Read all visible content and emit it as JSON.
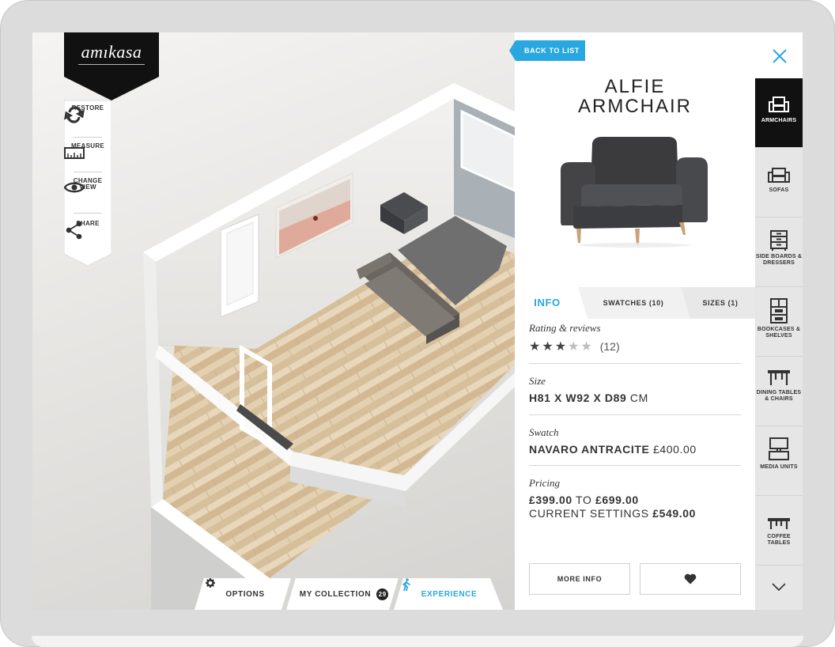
{
  "brand": {
    "logo_text": "amıkasa"
  },
  "toolbar": {
    "items": [
      {
        "label": "RESTORE",
        "icon": "restore-icon"
      },
      {
        "label": "MEASURE",
        "icon": "ruler-icon"
      },
      {
        "label_line1": "CHANGE",
        "label_line2": "VIEW",
        "icon": "eye-icon"
      },
      {
        "label": "SHARE",
        "icon": "share-icon"
      }
    ]
  },
  "bottom_bar": {
    "options_label": "OPTIONS",
    "collection_label": "MY COLLECTION",
    "collection_count": "29",
    "experience_label": "EXPERIENCE"
  },
  "panel": {
    "back_label": "BACK TO LIST",
    "title_line1": "ALFIE",
    "title_line2": "ARMCHAIR",
    "tabs": [
      {
        "label": "INFO",
        "active": true
      },
      {
        "label": "SWATCHES (10)",
        "active": false
      },
      {
        "label": "SIZES (1)",
        "active": false
      }
    ],
    "rating": {
      "heading": "Rating & reviews",
      "stars_filled": 3,
      "stars_total": 5,
      "count": "(12)"
    },
    "size": {
      "heading": "Size",
      "value_bold": "H81 X W92 X D89",
      "unit": " CM"
    },
    "swatch": {
      "heading": "Swatch",
      "name": "NAVARO ANTRACITE",
      "price": " £400.00"
    },
    "pricing": {
      "heading": "Pricing",
      "from": "£399.00",
      "to_word": " TO ",
      "to": "£699.00",
      "current_label": "CURRENT SETTINGS ",
      "current": "£549.00"
    },
    "more_info_label": "MORE INFO"
  },
  "categories": [
    {
      "label": "ARMCHAIRS",
      "active": true
    },
    {
      "label": "SOFAS",
      "active": false
    },
    {
      "label": "SIDE BOARDS & DRESSERS",
      "active": false
    },
    {
      "label": "BOOKCASES & SHELVES",
      "active": false
    },
    {
      "label": "DINING TABLES & CHAIRS",
      "active": false
    },
    {
      "label": "MEDIA UNITS",
      "active": false
    },
    {
      "label": "COFFEE TABLES",
      "active": false
    }
  ],
  "colors": {
    "accent": "#29a7e1",
    "dark": "#111111",
    "sofa": "#6b6661",
    "armchair_model": "#3b3b3d"
  }
}
